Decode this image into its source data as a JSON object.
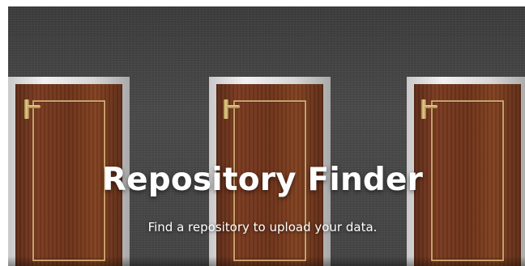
{
  "hero": {
    "title": "Repository Finder",
    "subtitle": "Find a repository to upload your data.",
    "background": "three-doors-photo",
    "colors": {
      "wall": "#454645",
      "door_wood": "#6c3219",
      "door_frame": "#e5e5e5",
      "inlay_trim": "#c6a26a",
      "handle_brass": "#d4b872",
      "text": "#ffffff"
    }
  }
}
